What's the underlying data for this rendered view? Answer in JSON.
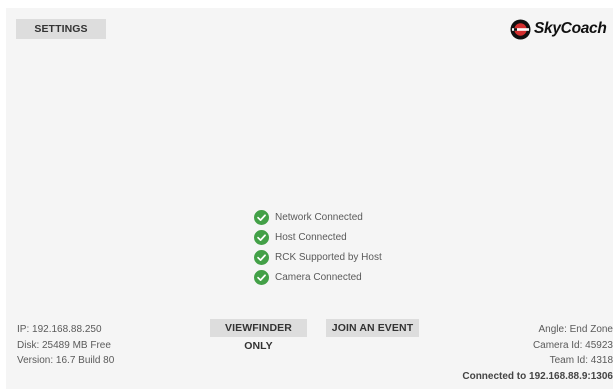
{
  "header": {
    "settings_label": "SETTINGS",
    "brand_name": "SkyCoach",
    "brand_color": "#d32f2f"
  },
  "status": {
    "check_color": "#43a047",
    "items": [
      {
        "label": "Network Connected",
        "state": "ok",
        "icon": "check-circle-icon"
      },
      {
        "label": "Host Connected",
        "state": "ok",
        "icon": "check-circle-icon"
      },
      {
        "label": "RCK Supported by Host",
        "state": "ok",
        "icon": "check-circle-icon"
      },
      {
        "label": "Camera Connected",
        "state": "ok",
        "icon": "check-circle-icon"
      }
    ]
  },
  "actions": {
    "viewfinder_label": "VIEWFINDER ONLY",
    "join_event_label": "JOIN AN EVENT"
  },
  "device_info": {
    "ip": "IP: 192.168.88.250",
    "disk": "Disk: 25489 MB Free",
    "version": "Version: 16.7 Build 80"
  },
  "camera_info": {
    "angle": "Angle: End Zone",
    "camera_id": "Camera Id: 45923",
    "team_id": "Team Id: 4318",
    "connection": "Connected to 192.168.88.9:1306"
  }
}
